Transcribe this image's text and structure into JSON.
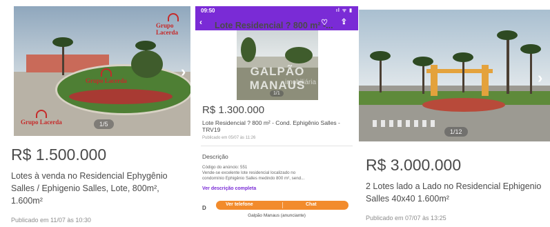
{
  "cards": [
    {
      "photo_counter": "1/5",
      "logo_text": "Grupo Lacerda",
      "price": "R$ 1.500.000",
      "title": "Lotes à venda no Residencial Ephygênio Salles / Ephigenio Salles, Lote, 800m², 1.600m²",
      "published": "Publicado em 11/07 às 10:30"
    },
    {
      "status_time": "09:50",
      "status_icons": "ıl ᯤ ▮",
      "app_title": "Lote Residencial ? 800 m² -...",
      "photo_counter": "1/1",
      "watermark": "GALPÃO MANAUS",
      "watermark_sub": "imobiliária",
      "price": "R$ 1.300.000",
      "title": "Lote Residencial ? 800 m² - Cond. Ephigênio Salles - TRV19",
      "published": "Publicado em 05/07 às 11:26",
      "description_heading": "Descrição",
      "description_lines": [
        "Código do anúncio: 551",
        "Vende-se excelente lote residencial localizado no",
        "condomínio Ephigênio Salles medindo 800 m², send..."
      ],
      "see_full_description": "Ver descrição completa",
      "truncated_heading": "D",
      "phone_button": "Ver telefone",
      "chat_button": "Chat",
      "advertiser": "Galpão Manaus (anunciante)"
    },
    {
      "photo_counter": "1/12",
      "price": "R$ 3.000.000",
      "title": "2 Lotes lado a Lado no Residencial Ephigenio Salles 40x40 1.600m²",
      "published": "Publicado em 07/07 às 13:25"
    }
  ],
  "icons": {
    "next": "chevron-right-icon",
    "back": "arrow-left-icon",
    "favorite": "heart-icon",
    "share": "share-icon"
  },
  "colors": {
    "accent_purple": "#7a2bd6",
    "button_orange": "#f28b2c",
    "text_gray": "#4a4a4a"
  }
}
